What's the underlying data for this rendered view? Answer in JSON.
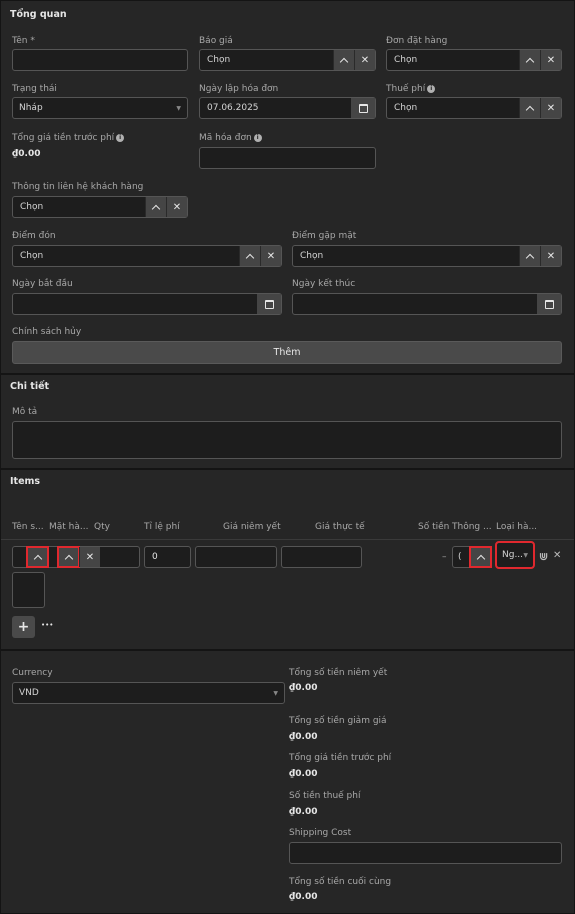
{
  "overview": {
    "title": "Tổng quan",
    "name_label": "Tên *",
    "quote_label": "Báo giá",
    "quote_value": "Chọn",
    "order_label": "Đơn đặt hàng",
    "order_value": "Chọn",
    "status_label": "Trạng thái",
    "status_value": "Nháp",
    "invoice_date_label": "Ngày lập hóa đơn",
    "invoice_date_value": "07.06.2025",
    "tax_label": "Thuế phí",
    "tax_value": "Chọn",
    "pretax_total_label": "Tổng giá tiền trước phí",
    "pretax_total_value": "₫0.00",
    "invoice_code_label": "Mã hóa đơn",
    "contact_label": "Thông tin liên hệ khách hàng",
    "contact_value": "Chọn",
    "pickup_label": "Điểm đón",
    "pickup_value": "Chọn",
    "meeting_label": "Điểm gặp mặt",
    "meeting_value": "Chọn",
    "start_date_label": "Ngày bắt đầu",
    "end_date_label": "Ngày kết thúc",
    "cancel_policy_label": "Chính sách hủy",
    "add_button": "Thêm"
  },
  "details": {
    "title": "Chi tiết",
    "description_label": "Mô tả"
  },
  "items": {
    "title": "Items",
    "columns": [
      "Tên s...",
      "Mặt hà...",
      "Qty",
      "Tỉ lệ phí",
      "Giá niêm yết",
      "Giá thực tế",
      "Số tiền",
      "Thông ...",
      "Loại hà..."
    ],
    "row": {
      "rate_value": "0",
      "amount_dash": "–",
      "info_partial": "(",
      "type_value": "Ng...",
      "more_label": "•••"
    }
  },
  "totals": {
    "currency_label": "Currency",
    "currency_value": "VND",
    "list_total_label": "Tổng số tiền niêm yết",
    "list_total_value": "₫0.00",
    "discount_label": "Tổng số tiền giảm giá",
    "discount_value": "₫0.00",
    "pretax_label": "Tổng giá tiền trước phí",
    "pretax_value": "₫0.00",
    "tax_amount_label": "Số tiền thuế phí",
    "tax_amount_value": "₫0.00",
    "shipping_label": "Shipping Cost",
    "final_total_label": "Tổng số tiền cuối cùng",
    "final_total_value": "₫0.00"
  },
  "icons": {
    "chevron": "chevron-up-icon",
    "close": "close-icon",
    "calendar": "calendar-icon",
    "plus": "plus-icon",
    "drag": "drag-handle-icon",
    "info": "info-icon"
  },
  "colors": {
    "highlight": "#e0282e",
    "background": "#2b2b2b",
    "input": "#1d1d1d",
    "button": "#454545"
  }
}
